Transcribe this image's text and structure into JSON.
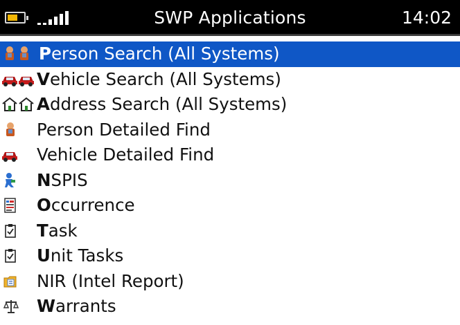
{
  "status_bar": {
    "title": "SWP Applications",
    "time": "14:02"
  },
  "colors": {
    "selection": "#0f57c6",
    "status_bg": "#000000",
    "battery": "#f2b705"
  },
  "menu": [
    {
      "key": "P",
      "rest": "erson Search (All Systems)",
      "icon": "two-persons-icon",
      "selected": true
    },
    {
      "key": "V",
      "rest": "ehicle Search (All Systems)",
      "icon": "two-vehicles-icon"
    },
    {
      "key": "A",
      "rest": "ddress Search (All Systems)",
      "icon": "two-houses-icon"
    },
    {
      "key": "",
      "rest": "Person Detailed Find",
      "icon": "person-icon"
    },
    {
      "key": "",
      "rest": "Vehicle Detailed Find",
      "icon": "vehicle-icon"
    },
    {
      "key": "N",
      "rest": "SPIS",
      "icon": "nspis-figure-icon"
    },
    {
      "key": "O",
      "rest": "ccurrence",
      "icon": "occurrence-form-icon"
    },
    {
      "key": "T",
      "rest": "ask",
      "icon": "checklist-icon"
    },
    {
      "key": "U",
      "rest": "nit Tasks",
      "icon": "checklist-icon"
    },
    {
      "key": "",
      "rest": "NIR (Intel Report)",
      "icon": "folder-document-icon"
    },
    {
      "key": "W",
      "rest": "arrants",
      "icon": "scales-icon"
    }
  ]
}
